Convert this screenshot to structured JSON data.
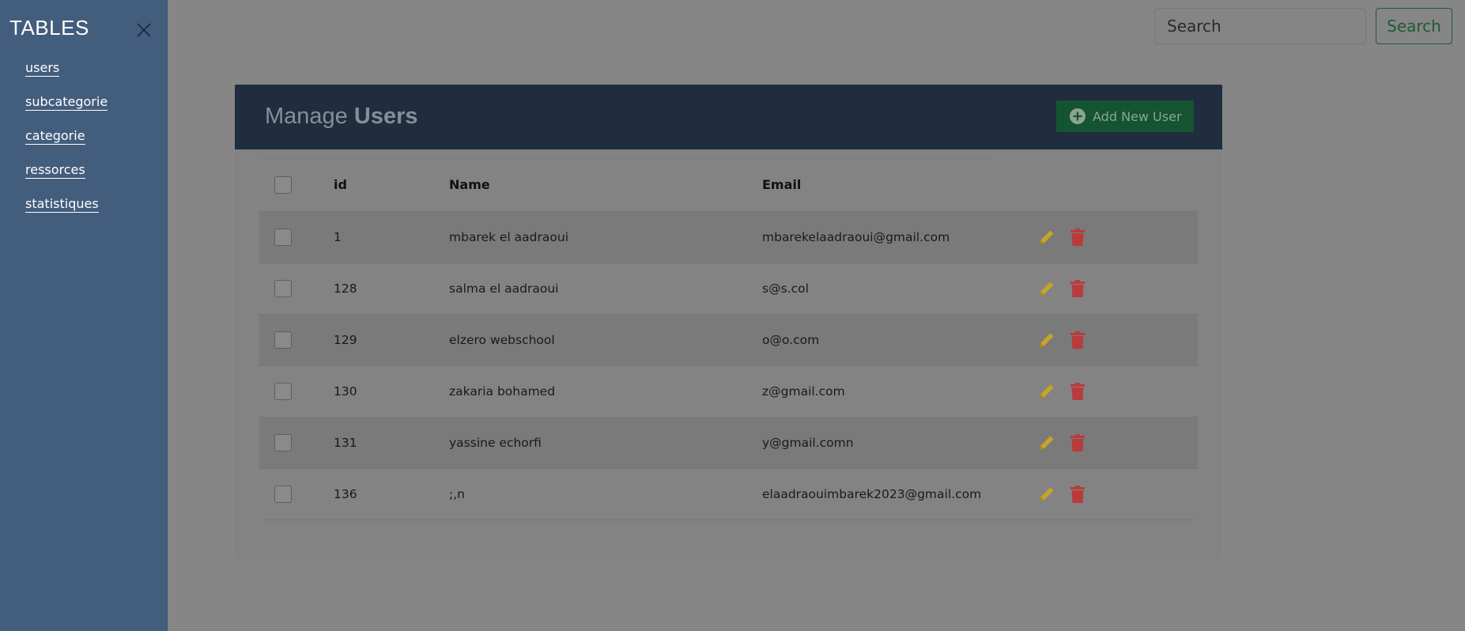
{
  "sidebar": {
    "title": "TABLES",
    "close_icon": "close-icon",
    "items": [
      {
        "label": "users"
      },
      {
        "label": "subcategorie"
      },
      {
        "label": "categorie"
      },
      {
        "label": "ressorces"
      },
      {
        "label": "statistiques"
      }
    ]
  },
  "search": {
    "placeholder": "Search",
    "button_label": "Search"
  },
  "panel": {
    "title_prefix": "Manage",
    "title_bold": "Users",
    "add_button_label": "Add New User",
    "add_icon": "plus-circle-icon"
  },
  "table": {
    "columns": {
      "id": "id",
      "name": "Name",
      "email": "Email"
    },
    "rows": [
      {
        "id": "1",
        "name": "mbarek el aadraoui",
        "email": "mbarekelaadraoui@gmail.com"
      },
      {
        "id": "128",
        "name": "salma el aadraoui",
        "email": "s@s.col"
      },
      {
        "id": "129",
        "name": "elzero webschool",
        "email": "o@o.com"
      },
      {
        "id": "130",
        "name": "zakaria bohamed",
        "email": "z@gmail.com"
      },
      {
        "id": "131",
        "name": "yassine echorfi",
        "email": "y@gmail.comn"
      },
      {
        "id": "136",
        "name": ";,n",
        "email": "elaadraouimbarek2023@gmail.com"
      }
    ]
  },
  "colors": {
    "overlay_background": "#868686",
    "sidebar": "#435d7d",
    "panel_header": "#202d3f",
    "add_button": "#145432",
    "edit_icon": "#c7a32a",
    "delete_icon": "#b83c3c"
  },
  "icons": {
    "edit": "pencil-icon",
    "delete": "trash-icon"
  }
}
